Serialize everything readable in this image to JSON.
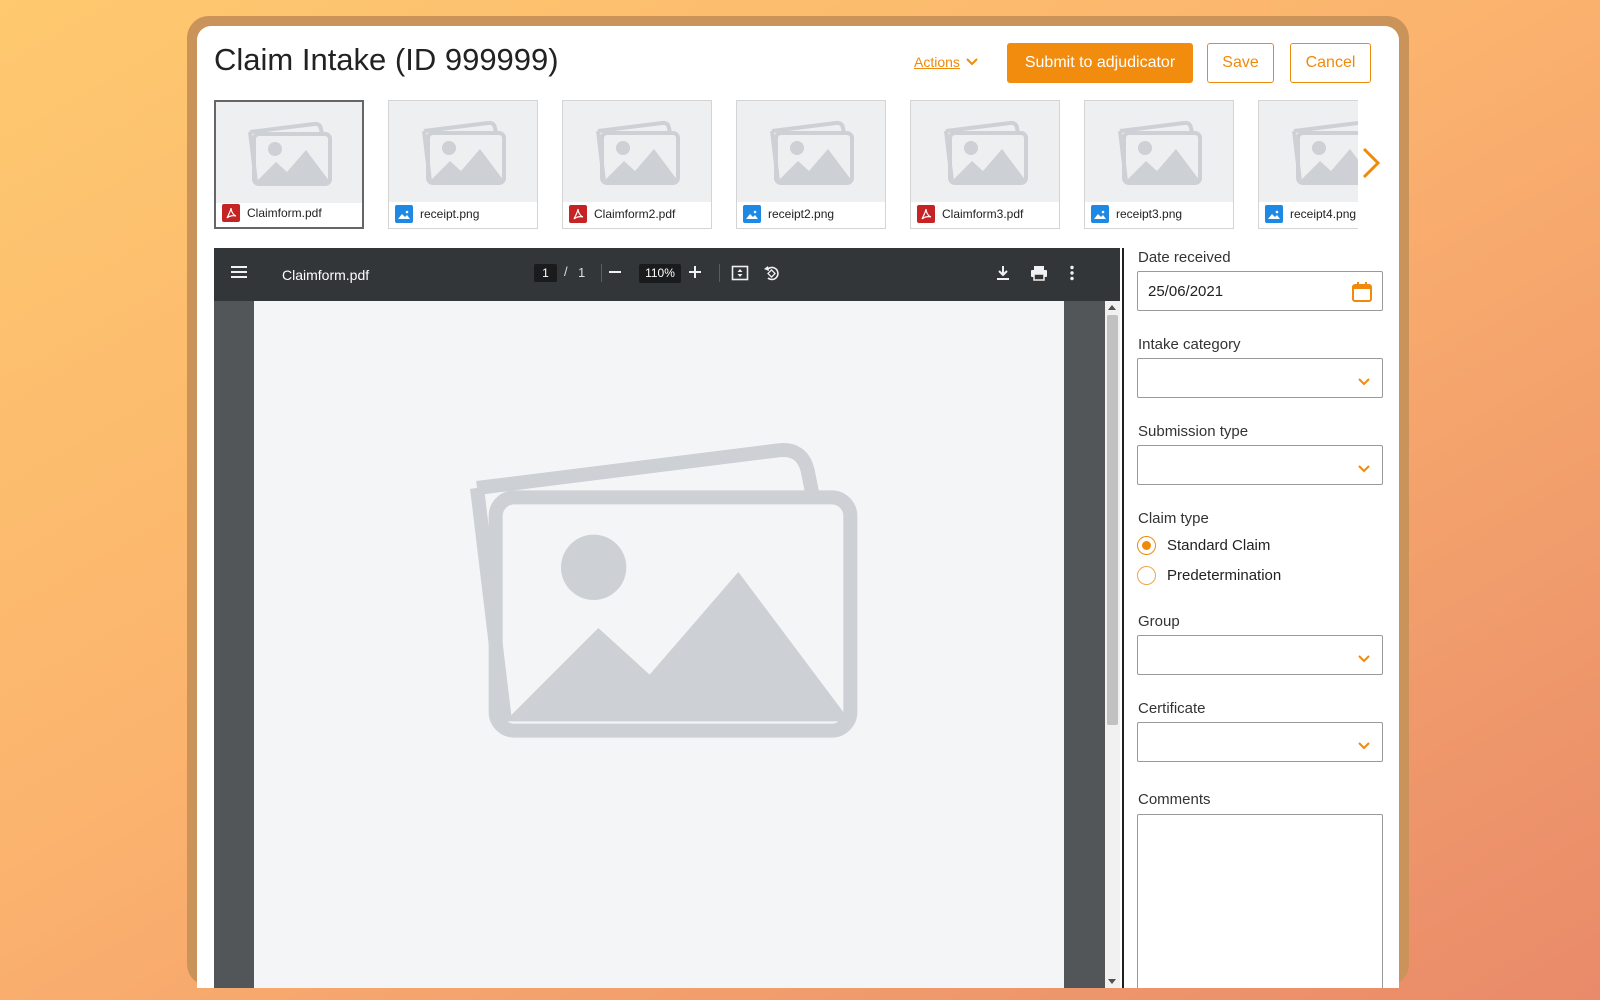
{
  "header": {
    "title": "Claim Intake (ID 999999)",
    "actions_label": "Actions",
    "submit_label": "Submit to adjudicator",
    "save_label": "Save",
    "cancel_label": "Cancel"
  },
  "thumbnails": [
    {
      "name": "Claimform.pdf",
      "type": "pdf",
      "selected": true
    },
    {
      "name": "receipt.png",
      "type": "image",
      "selected": false
    },
    {
      "name": "Claimform2.pdf",
      "type": "pdf",
      "selected": false
    },
    {
      "name": "receipt2.png",
      "type": "image",
      "selected": false
    },
    {
      "name": "Claimform3.pdf",
      "type": "pdf",
      "selected": false
    },
    {
      "name": "receipt3.png",
      "type": "image",
      "selected": false
    },
    {
      "name": "receipt4.png",
      "type": "image",
      "selected": false
    }
  ],
  "viewer": {
    "filename": "Claimform.pdf",
    "current_page": "1",
    "separator": "/",
    "total_pages": "1",
    "zoom": "110%"
  },
  "form": {
    "date_received_label": "Date received",
    "date_received_value": "25/06/2021",
    "intake_category_label": "Intake category",
    "intake_category_value": "",
    "submission_type_label": "Submission type",
    "submission_type_value": "",
    "claim_type_label": "Claim type",
    "claim_type_options": [
      {
        "label": "Standard Claim",
        "checked": true
      },
      {
        "label": "Predetermination",
        "checked": false
      }
    ],
    "group_label": "Group",
    "group_value": "",
    "certificate_label": "Certificate",
    "certificate_value": "",
    "comments_label": "Comments",
    "comments_value": ""
  },
  "colors": {
    "accent": "#f28c0e",
    "pdf_icon": "#c62424",
    "image_icon": "#1e88e5",
    "viewer_toolbar": "#323639",
    "viewer_bg": "#525659"
  }
}
